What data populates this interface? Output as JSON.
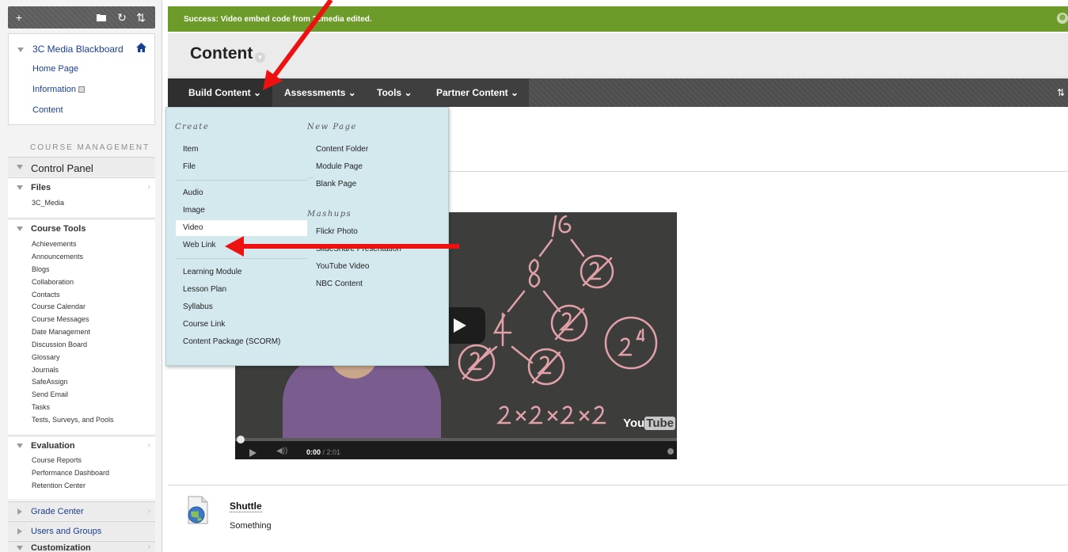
{
  "sidebar": {
    "course_title": "3C Media Blackboard",
    "course_links": [
      "Home Page",
      "Information",
      "Content"
    ],
    "course_management_label": "COURSE MANAGEMENT",
    "control_panel": "Control Panel",
    "files": {
      "label": "Files",
      "items": [
        "3C_Media"
      ]
    },
    "course_tools": {
      "label": "Course Tools",
      "items": [
        "Achievements",
        "Announcements",
        "Blogs",
        "Collaboration",
        "Contacts",
        "Course Calendar",
        "Course Messages",
        "Date Management",
        "Discussion Board",
        "Glossary",
        "Journals",
        "SafeAssign",
        "Send Email",
        "Tasks",
        "Tests, Surveys, and Pools"
      ]
    },
    "evaluation": {
      "label": "Evaluation",
      "items": [
        "Course Reports",
        "Performance Dashboard",
        "Retention Center"
      ]
    },
    "grade_center": "Grade Center",
    "users_and_groups": "Users and Groups",
    "customization": "Customization",
    "toolbar": {
      "add": "+",
      "folder": "folder-icon",
      "refresh": "↻",
      "sort": "⇅"
    }
  },
  "success": {
    "message": "Success: Video embed code from 3cmedia edited.",
    "close": "⊗"
  },
  "page": {
    "title": "Content"
  },
  "action_bar": {
    "build_content": "Build Content",
    "assessments": "Assessments",
    "tools": "Tools",
    "partner_content": "Partner Content",
    "sort": "⇅"
  },
  "dropdown": {
    "create_head": "Create",
    "create_group1": [
      "Item",
      "File"
    ],
    "create_group2": [
      "Audio",
      "Image",
      "Video",
      "Web Link"
    ],
    "create_group3": [
      "Learning Module",
      "Lesson Plan",
      "Syllabus",
      "Course Link",
      "Content Package (SCORM)"
    ],
    "newpage_head": "New Page",
    "newpage_items": [
      "Content Folder",
      "Module Page",
      "Blank Page"
    ],
    "mashups_head": "Mashups",
    "mashups_items": [
      "Flickr Photo",
      "SlideShare Presentation",
      "YouTube Video",
      "NBC Content"
    ]
  },
  "video": {
    "time_current": "0:00",
    "time_total": "/ 2:01",
    "logo": "You",
    "logo_tube": "Tube"
  },
  "item": {
    "title": "Shuttle",
    "description": "Something"
  },
  "colors": {
    "success": "#6c9b2a",
    "action_bar": "#4e4e4e",
    "dropdown": "#d4e9ee",
    "link": "#1a3f8f",
    "arrow": "#ee1111"
  }
}
